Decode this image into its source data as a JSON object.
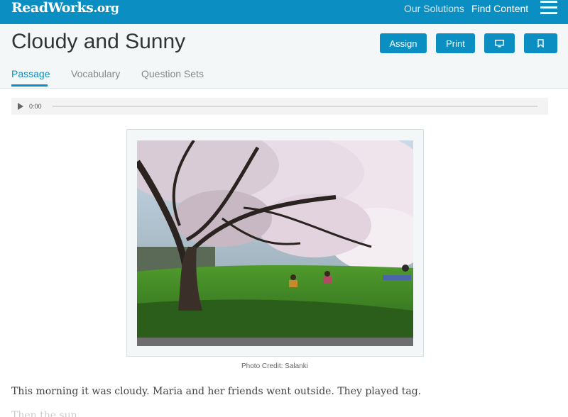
{
  "topbar": {
    "logo_main": "ReadWorks",
    "logo_tld": ".org",
    "nav": [
      {
        "label": "Our Solutions"
      },
      {
        "label": "Find Content"
      }
    ],
    "menu_icon": "hamburger-menu-icon"
  },
  "header": {
    "title": "Cloudy and Sunny",
    "buttons": {
      "assign": "Assign",
      "print": "Print",
      "present_icon": "monitor-icon",
      "bookmark_icon": "bookmark-icon"
    },
    "tabs": [
      {
        "label": "Passage",
        "active": true
      },
      {
        "label": "Vocabulary",
        "active": false
      },
      {
        "label": "Question Sets",
        "active": false
      }
    ]
  },
  "audio": {
    "time": "0:00",
    "progress": 0,
    "play_icon": "play-icon"
  },
  "figure": {
    "credit": "Photo Credit: Salanki"
  },
  "passage": {
    "paragraphs": [
      "This morning it was cloudy. Maria and her friends went outside. They played tag.",
      "Then the sun"
    ]
  },
  "colors": {
    "brand": "#0b8ec2",
    "header_bg": "#f3f7f8"
  }
}
